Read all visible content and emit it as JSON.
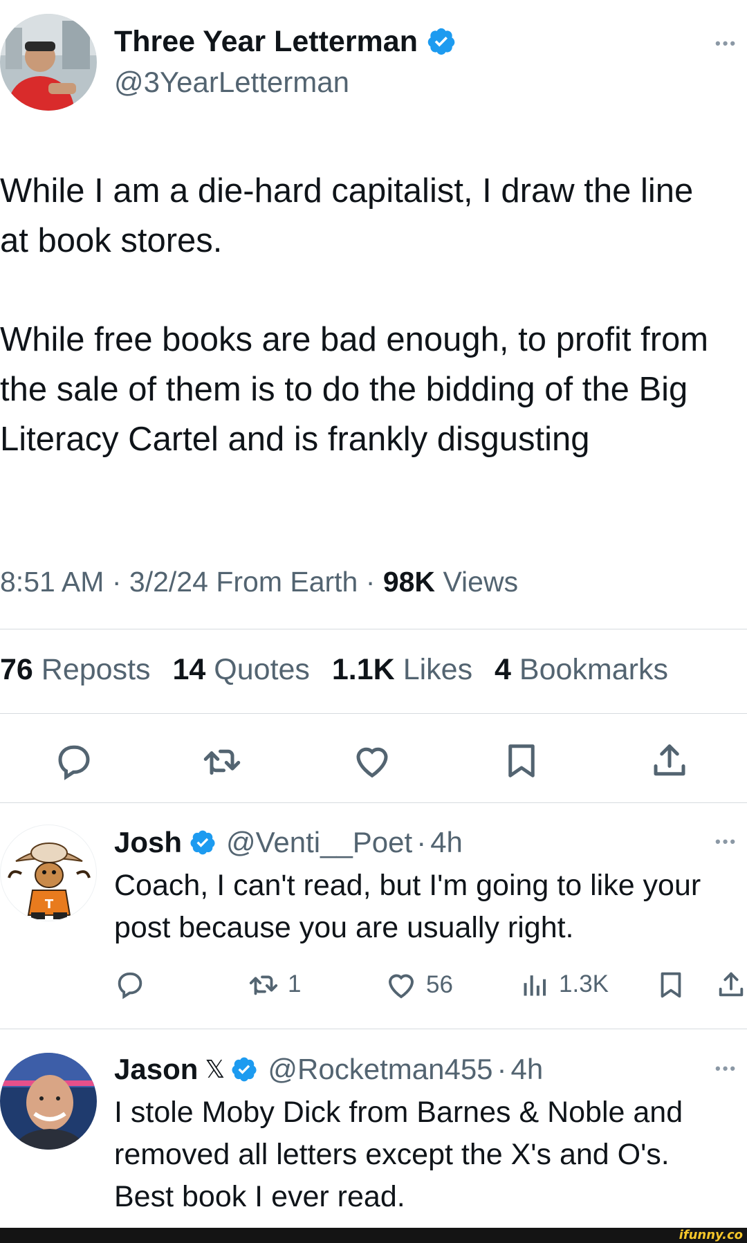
{
  "main_tweet": {
    "author_name": "Three Year Letterman",
    "handle": "@3YearLetterman",
    "text_p1": "While I am a die-hard capitalist, I draw the line at book stores.",
    "text_p2": "While free books are bad enough, to profit from the sale of them is to do the bidding of the Big Literacy Cartel and is frankly disgusting",
    "meta": {
      "time": "8:51 AM",
      "date": "3/2/24",
      "source": "From Earth",
      "views_count": "98K",
      "views_label": "Views",
      "sep": "·"
    },
    "stats": {
      "reposts_count": "76",
      "reposts_label": "Reposts",
      "quotes_count": "14",
      "quotes_label": "Quotes",
      "likes_count": "1.1K",
      "likes_label": "Likes",
      "bookmarks_count": "4",
      "bookmarks_label": "Bookmarks"
    }
  },
  "replies": [
    {
      "author_name": "Josh",
      "handle": "@Venti__Poet",
      "sep": "·",
      "age": "4h",
      "text": "Coach, I can't read, but I'm going to like your post because you are usually right.",
      "reposts": "1",
      "likes": "56",
      "views": "1.3K"
    },
    {
      "author_name": "Jason",
      "x_badge": "𝕏",
      "handle": "@Rocketman455",
      "sep": "·",
      "age": "4h",
      "text": "I stole Moby Dick from Barnes & Noble and removed all letters except the X's and O's. Best book I ever read."
    }
  ],
  "watermark": "ifunny.co",
  "colors": {
    "verified": "#1d9bf0",
    "text": "#0f1419",
    "secondary": "#536471",
    "divider": "#d6dbdf",
    "watermark": "#f6c62a"
  },
  "icons": [
    "verified-badge-icon",
    "more-icon",
    "reply-icon",
    "repost-icon",
    "like-icon",
    "bookmark-icon",
    "share-icon",
    "views-icon",
    "x-logo-icon"
  ]
}
